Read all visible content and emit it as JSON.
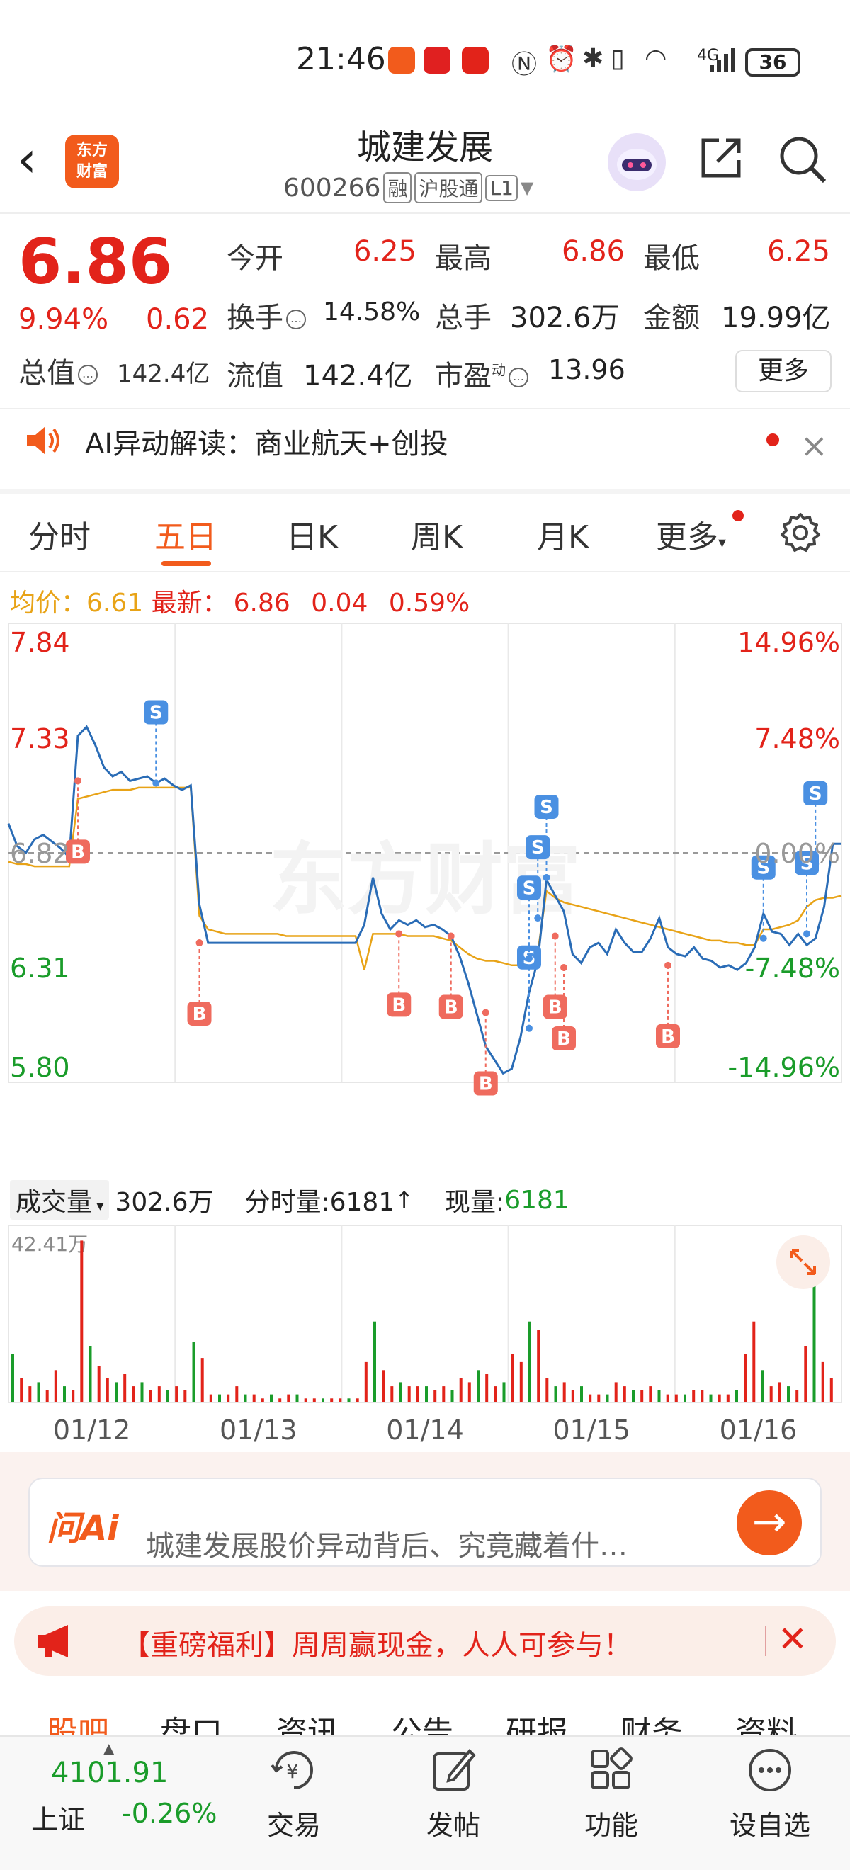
{
  "status_bar": {
    "time": "21:46",
    "battery": "36",
    "network": "4G"
  },
  "header": {
    "title": "城建发展",
    "code": "600266",
    "tags": [
      "融",
      "沪股通",
      "L1"
    ],
    "logo_text": [
      "东方",
      "财富"
    ]
  },
  "quote": {
    "price": "6.86",
    "change_pct": "9.94%",
    "change": "0.62",
    "market_cap_label": "总值",
    "market_cap": "142.4亿",
    "fields": [
      {
        "label": "今开",
        "value": "6.25",
        "color": "red"
      },
      {
        "label": "最高",
        "value": "6.86",
        "color": "red"
      },
      {
        "label": "最低",
        "value": "6.25",
        "color": "red"
      },
      {
        "label": "换手",
        "value": "14.58%",
        "color": "dark"
      },
      {
        "label": "总手",
        "value": "302.6万",
        "color": "dark"
      },
      {
        "label": "金额",
        "value": "19.99亿",
        "color": "dark"
      },
      {
        "label": "流值",
        "value": "142.4亿",
        "color": "dark"
      },
      {
        "label": "市盈",
        "value": "13.96",
        "color": "dark",
        "superscript": "动"
      }
    ],
    "more_label": "更多"
  },
  "ai_banner": {
    "text": "AI异动解读：商业航天+创投"
  },
  "tabs": {
    "items": [
      "分时",
      "五日",
      "日K",
      "周K",
      "月K",
      "更多"
    ],
    "active": "五日"
  },
  "avg_row": {
    "avg_label": "均价：",
    "avg_value": "6.61",
    "latest_label": "最新：",
    "latest_value": "6.86",
    "change": "0.04",
    "change_pct": "0.59%"
  },
  "chart_data": {
    "type": "line",
    "title": "",
    "x": [
      "01/12",
      "01/13",
      "01/14",
      "01/15",
      "01/16"
    ],
    "y_left_ticks": [
      "7.84",
      "7.33",
      "6.82",
      "6.31",
      "5.80"
    ],
    "y_right_ticks": [
      "14.96%",
      "7.48%",
      "0.00%",
      "-7.48%",
      "-14.96%"
    ],
    "ylim": [
      5.8,
      7.84
    ],
    "reference": 6.82,
    "series": [
      {
        "values": [
          6.95,
          6.85,
          6.82,
          6.88,
          6.9,
          6.87,
          6.84,
          6.8,
          7.34,
          7.38,
          7.3,
          7.2,
          7.16,
          7.18,
          7.14,
          7.15,
          7.16,
          7.13,
          7.15,
          7.12,
          7.1,
          7.12,
          6.59,
          6.42,
          6.42,
          6.42,
          6.42,
          6.42,
          6.42,
          6.42,
          6.42,
          6.42,
          6.42,
          6.42,
          6.42,
          6.42,
          6.42,
          6.42,
          6.42,
          6.42,
          6.42,
          6.5,
          6.71,
          6.55,
          6.48,
          6.52,
          6.5,
          6.52,
          6.49,
          6.5,
          6.48,
          6.45,
          6.36,
          6.24,
          6.1,
          5.96,
          5.9,
          5.84,
          5.86,
          6.0,
          6.2,
          6.34,
          6.7,
          6.63,
          6.56,
          6.37,
          6.33,
          6.4,
          6.42,
          6.37,
          6.48,
          6.42,
          6.38,
          6.38,
          6.44,
          6.53,
          6.4,
          6.37,
          6.36,
          6.4,
          6.35,
          6.34,
          6.31,
          6.32,
          6.3,
          6.33,
          6.4,
          6.55,
          6.47,
          6.46,
          6.41,
          6.46,
          6.41,
          6.44,
          6.58,
          6.86,
          6.86
        ]
      },
      {
        "values": [
          6.78,
          6.77,
          6.77,
          6.76,
          6.76,
          6.76,
          6.76,
          6.76,
          7.06,
          7.07,
          7.08,
          7.09,
          7.1,
          7.1,
          7.1,
          7.11,
          7.11,
          7.11,
          7.11,
          7.11,
          7.11,
          7.11,
          6.54,
          6.48,
          6.47,
          6.46,
          6.46,
          6.46,
          6.46,
          6.46,
          6.46,
          6.46,
          6.45,
          6.45,
          6.45,
          6.45,
          6.45,
          6.45,
          6.45,
          6.45,
          6.45,
          6.3,
          6.46,
          6.46,
          6.46,
          6.46,
          6.45,
          6.45,
          6.45,
          6.45,
          6.44,
          6.43,
          6.4,
          6.37,
          6.35,
          6.34,
          6.34,
          6.33,
          6.32,
          6.32,
          6.33,
          6.38,
          6.65,
          6.62,
          6.6,
          6.59,
          6.58,
          6.57,
          6.56,
          6.55,
          6.54,
          6.53,
          6.52,
          6.51,
          6.5,
          6.49,
          6.48,
          6.47,
          6.46,
          6.45,
          6.44,
          6.43,
          6.43,
          6.42,
          6.42,
          6.41,
          6.41,
          6.48,
          6.48,
          6.49,
          6.5,
          6.52,
          6.58,
          6.61,
          6.62,
          6.62,
          6.63
        ]
      }
    ],
    "markers": [
      {
        "label": "B",
        "x": 8,
        "y": 7.14
      },
      {
        "label": "S",
        "x": 17,
        "y": 7.13
      },
      {
        "label": "B",
        "x": 22,
        "y": 6.42
      },
      {
        "label": "B",
        "x": 45,
        "y": 6.46
      },
      {
        "label": "B",
        "x": 51,
        "y": 6.45
      },
      {
        "label": "B",
        "x": 55,
        "y": 6.11
      },
      {
        "label": "S",
        "x": 60,
        "y": 6.04
      },
      {
        "label": "S",
        "x": 60,
        "y": 6.35
      },
      {
        "label": "S",
        "x": 61,
        "y": 6.53
      },
      {
        "label": "S",
        "x": 62,
        "y": 6.71
      },
      {
        "label": "B",
        "x": 63,
        "y": 6.45
      },
      {
        "label": "B",
        "x": 64,
        "y": 6.31
      },
      {
        "label": "B",
        "x": 76,
        "y": 6.32
      },
      {
        "label": "S",
        "x": 87,
        "y": 6.44
      },
      {
        "label": "S",
        "x": 92,
        "y": 6.46
      },
      {
        "label": "S",
        "x": 93,
        "y": 6.77
      }
    ],
    "volume": {
      "label": "成交量",
      "total": "302.6万",
      "tick_label": "分时量:6181",
      "current_label": "现量:",
      "current_value": "6181",
      "max_label": "42.41万",
      "values": [
        12,
        6,
        4,
        5,
        3,
        8,
        4,
        3,
        40,
        14,
        9,
        6,
        5,
        7,
        4,
        5,
        3,
        4,
        3,
        4,
        3,
        15,
        11,
        2,
        2,
        2,
        4,
        2,
        2,
        1,
        2,
        1,
        2,
        2,
        1,
        1,
        1,
        1,
        1,
        1,
        1,
        10,
        20,
        8,
        4,
        5,
        4,
        4,
        4,
        3,
        4,
        3,
        6,
        5,
        8,
        7,
        4,
        5,
        12,
        10,
        20,
        18,
        6,
        4,
        5,
        3,
        4,
        2,
        2,
        2,
        5,
        4,
        3,
        3,
        4,
        3,
        2,
        2,
        2,
        3,
        3,
        2,
        2,
        2,
        3,
        12,
        20,
        8,
        4,
        5,
        4,
        3,
        14,
        30,
        10,
        6
      ]
    }
  },
  "ask_ai": {
    "logo": "问Ai",
    "placeholder": "城建发展股价异动背后、究竟藏着什…"
  },
  "promo": {
    "text": "【重磅福利】周周赢现金，人人可参与！"
  },
  "sub_tabs": [
    "股吧",
    "盘口",
    "资讯",
    "公告",
    "研报",
    "财务",
    "资料"
  ],
  "bottom_nav": {
    "index_value": "4101.91",
    "index_name": "上证",
    "index_change": "-0.26%",
    "items": [
      "交易",
      "发帖",
      "功能",
      "设自选"
    ]
  },
  "colors": {
    "accent": "#f25b1c",
    "up": "#e2231a",
    "down": "#1a9c2a",
    "avg_line": "#e8a317",
    "price_line": "#2a6cb6"
  }
}
